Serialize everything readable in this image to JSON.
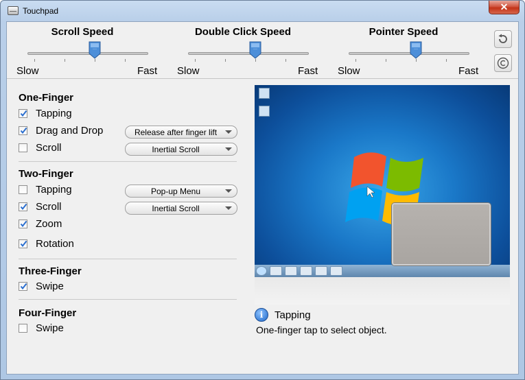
{
  "window": {
    "title": "Touchpad",
    "close_glyph": "✕"
  },
  "speeds": {
    "scroll": {
      "label": "Scroll Speed",
      "min_label": "Slow",
      "max_label": "Fast",
      "level": 0.5
    },
    "double_click": {
      "label": "Double Click Speed",
      "min_label": "Slow",
      "max_label": "Fast",
      "level": 0.5
    },
    "pointer": {
      "label": "Pointer Speed",
      "min_label": "Slow",
      "max_label": "Fast",
      "level": 0.5
    }
  },
  "toolbar": {
    "reset_icon": "reset-icon",
    "copyright_icon": "copyright-icon"
  },
  "one_finger": {
    "title": "One-Finger",
    "tapping": {
      "label": "Tapping",
      "checked": true
    },
    "drag_and_drop": {
      "label": "Drag and Drop",
      "checked": true,
      "option": "Release after finger lift"
    },
    "scroll": {
      "label": "Scroll",
      "checked": false,
      "option": "Inertial Scroll"
    }
  },
  "two_finger": {
    "title": "Two-Finger",
    "tapping": {
      "label": "Tapping",
      "checked": false,
      "option": "Pop-up Menu"
    },
    "scroll": {
      "label": "Scroll",
      "checked": true,
      "option": "Inertial Scroll"
    },
    "zoom": {
      "label": "Zoom",
      "checked": true
    },
    "rotation": {
      "label": "Rotation",
      "checked": true
    }
  },
  "three_finger": {
    "title": "Three-Finger",
    "swipe": {
      "label": "Swipe",
      "checked": true
    }
  },
  "four_finger": {
    "title": "Four-Finger",
    "swipe": {
      "label": "Swipe",
      "checked": false
    }
  },
  "info": {
    "title": "Tapping",
    "description": "One-finger tap to select object.",
    "icon": "info-icon"
  },
  "colors": {
    "accent": "#2c6fcf",
    "close": "#c33318"
  }
}
